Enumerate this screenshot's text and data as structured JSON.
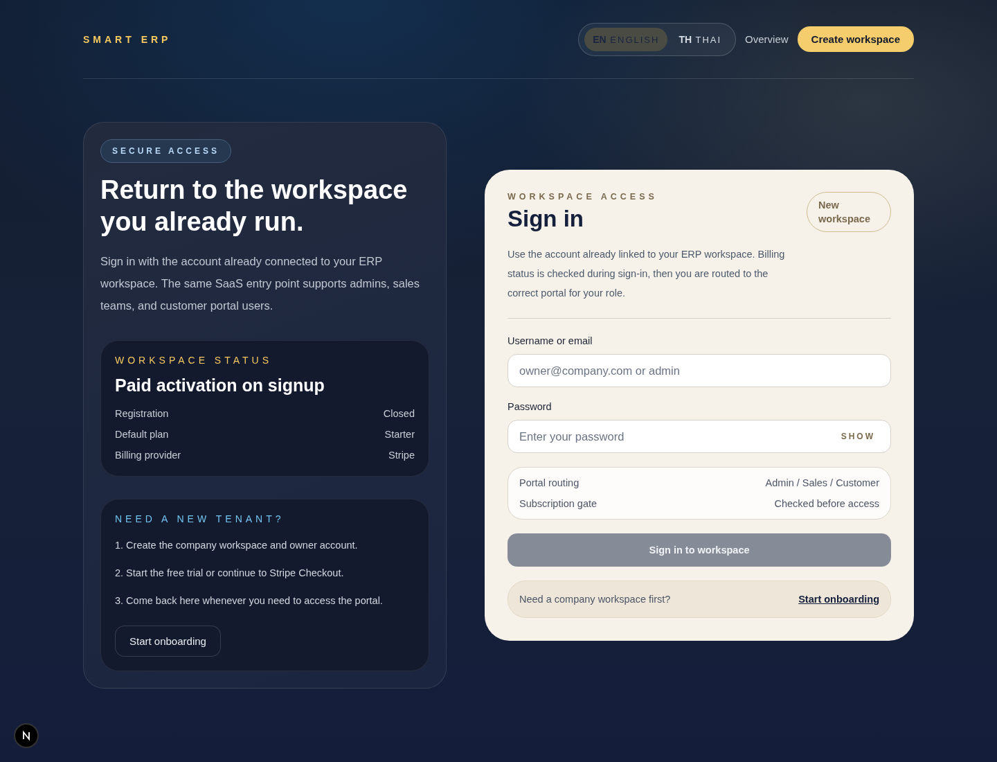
{
  "brand": "SMART ERP",
  "languages": [
    {
      "code": "EN",
      "name": "ENGLISH",
      "selected": true
    },
    {
      "code": "TH",
      "name": "THAI",
      "selected": false
    }
  ],
  "nav": {
    "link": "Overview",
    "cta": "Create workspace"
  },
  "intro": {
    "badge": "SECURE ACCESS",
    "title": "Return to the workspace you already run.",
    "text": "Sign in with the account already connected to your ERP workspace. The same SaaS entry point supports admins, sales teams, and customer portal users."
  },
  "status": {
    "eyebrow": "WORKSPACE STATUS",
    "title": "Paid activation on signup",
    "rows": [
      {
        "label": "Registration",
        "value": "Closed"
      },
      {
        "label": "Default plan",
        "value": "Starter"
      },
      {
        "label": "Billing provider",
        "value": "Stripe"
      }
    ]
  },
  "tenant": {
    "eyebrow": "NEED A NEW TENANT?",
    "steps": [
      "1. Create the company workspace and owner account.",
      "2. Start the free trial or continue to Stripe Checkout.",
      "3. Come back here whenever you need to access the portal."
    ],
    "button": "Start onboarding"
  },
  "signin": {
    "eyebrow": "WORKSPACE ACCESS",
    "title": "Sign in",
    "new_button": "New workspace",
    "text": "Use the account already linked to your ERP workspace. Billing status is checked during sign-in, then you are routed to the correct portal for your role.",
    "username": {
      "label": "Username or email",
      "placeholder": "owner@company.com or admin"
    },
    "password": {
      "label": "Password",
      "placeholder": "Enter your password",
      "toggle": "SHOW"
    },
    "info": [
      {
        "label": "Portal routing",
        "value": "Admin / Sales / Customer"
      },
      {
        "label": "Subscription gate",
        "value": "Checked before access"
      }
    ],
    "submit": {
      "label": "Sign in to workspace",
      "disabled": true
    },
    "footer": {
      "text": "Need a company workspace first?",
      "link": "Start onboarding"
    }
  }
}
